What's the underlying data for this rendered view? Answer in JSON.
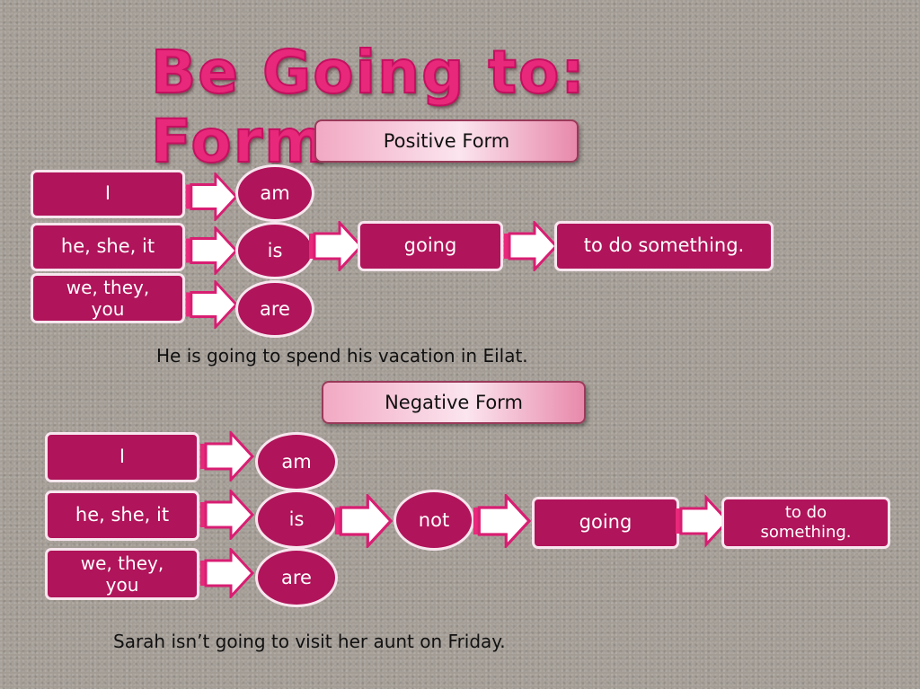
{
  "title": "Be Going to: Form",
  "positive": {
    "header": "Positive Form",
    "subjects": [
      "I",
      "he, she, it",
      "we, they, you"
    ],
    "verbs": [
      "am",
      "is",
      "are"
    ],
    "going": "going",
    "ending": "to do something.",
    "example": "He is going to spend his vacation in Eilat."
  },
  "negative": {
    "header": "Negative Form",
    "subjects": [
      "I",
      "he, she, it",
      "we, they, you"
    ],
    "verbs": [
      "am",
      "is",
      "are"
    ],
    "not": "not",
    "going": "going",
    "ending": "to do something.",
    "example": "Sarah isn’t going to visit her aunt on Friday."
  },
  "colors": {
    "box": "#b0145a",
    "title": "#e8287a",
    "arrow_fill": "#ffffff",
    "arrow_stroke": "#d81e72"
  }
}
